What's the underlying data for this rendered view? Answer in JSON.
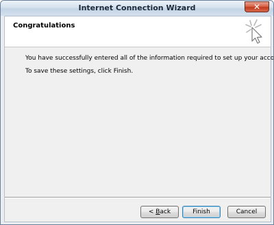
{
  "window": {
    "title": "Internet Connection Wizard",
    "close_symbol": "✕"
  },
  "header": {
    "heading": "Congratulations",
    "icon": "wizard-sparkle-cursor-icon"
  },
  "body": {
    "line1": "You have successfully entered all of the information required to set up your account.",
    "line2": "To save these settings, click Finish."
  },
  "buttons": {
    "back_prefix": "< ",
    "back_accel": "B",
    "back_rest": "ack",
    "finish": "Finish",
    "cancel": "Cancel"
  },
  "colors": {
    "close_red": "#c23a1d",
    "finish_focus": "#3c7fb1"
  }
}
